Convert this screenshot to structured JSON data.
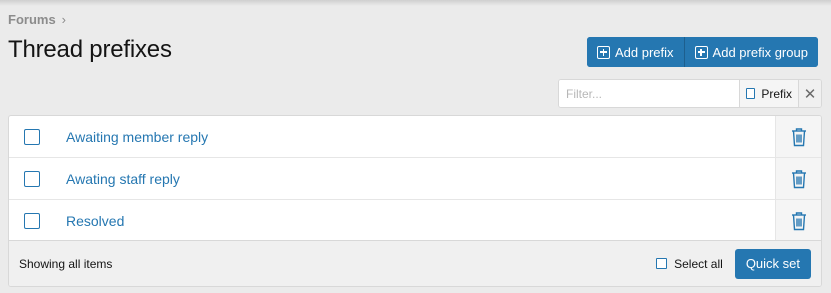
{
  "breadcrumb": {
    "item": "Forums",
    "separator": "›"
  },
  "page": {
    "title": "Thread prefixes"
  },
  "actions": {
    "add_prefix": "Add prefix",
    "add_prefix_group": "Add prefix group"
  },
  "filter": {
    "placeholder": "Filter...",
    "prefix_toggle": "Prefix",
    "clear_symbol": "✕"
  },
  "prefixes": [
    {
      "label": "Awaiting member reply"
    },
    {
      "label": "Awating staff reply"
    },
    {
      "label": "Resolved"
    }
  ],
  "footer": {
    "status": "Showing all items",
    "select_all": "Select all",
    "quick_set": "Quick set"
  },
  "colors": {
    "accent": "#2577b1",
    "background": "#ebebeb",
    "footer": "#f0f0f0"
  }
}
